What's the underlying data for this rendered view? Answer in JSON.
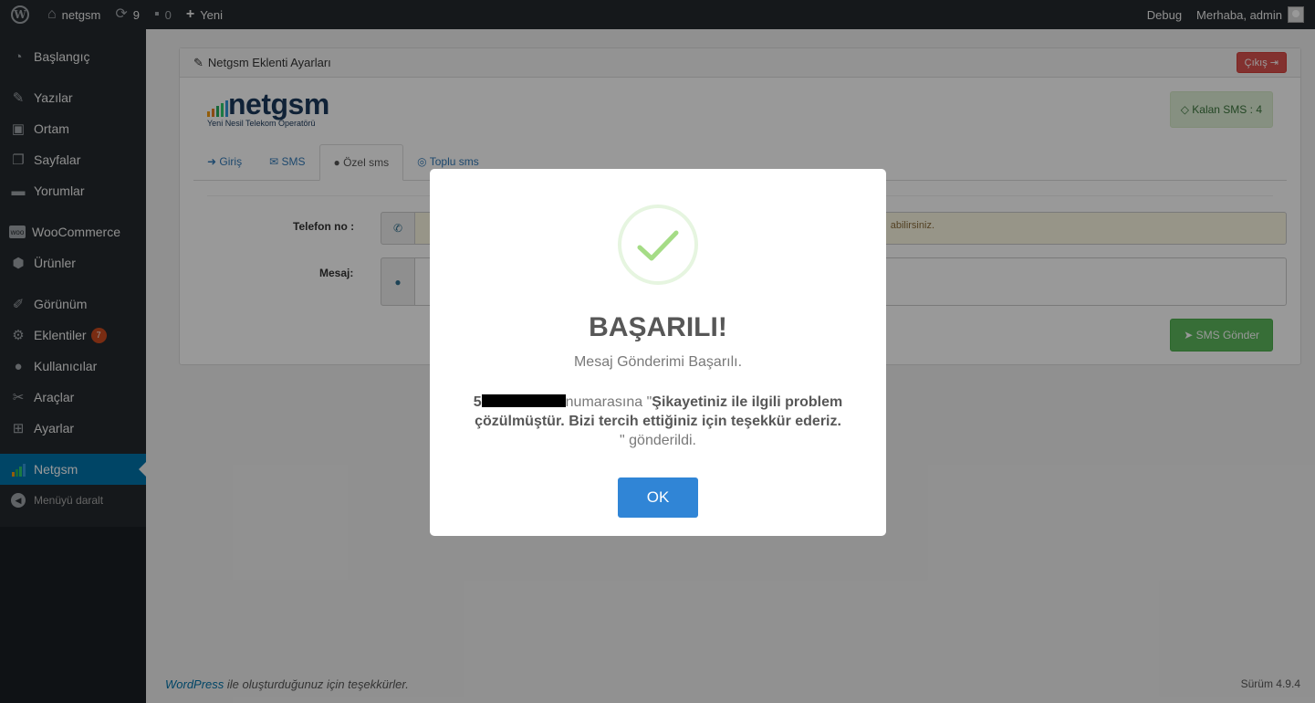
{
  "adminbar": {
    "site_name": "netgsm",
    "updates_count": "9",
    "comments_count": "0",
    "new_label": "Yeni",
    "debug_label": "Debug",
    "greeting": "Merhaba, admin"
  },
  "sidebar": {
    "items": [
      {
        "label": "Başlangıç",
        "icon": "dashboard-icon"
      },
      {
        "label": "Yazılar",
        "icon": "pin-icon"
      },
      {
        "label": "Ortam",
        "icon": "media-icon"
      },
      {
        "label": "Sayfalar",
        "icon": "pages-icon"
      },
      {
        "label": "Yorumlar",
        "icon": "comments-icon"
      },
      {
        "label": "WooCommerce",
        "icon": "woo-icon"
      },
      {
        "label": "Ürünler",
        "icon": "box-icon"
      },
      {
        "label": "Görünüm",
        "icon": "brush-icon"
      },
      {
        "label": "Eklentiler",
        "icon": "plugin-icon",
        "badge": "7"
      },
      {
        "label": "Kullanıcılar",
        "icon": "user-icon"
      },
      {
        "label": "Araçlar",
        "icon": "wrench-icon"
      },
      {
        "label": "Ayarlar",
        "icon": "settings-icon"
      },
      {
        "label": "Netgsm",
        "icon": "netgsm-bars-icon"
      }
    ],
    "collapse_label": "Menüyü daralt"
  },
  "panel": {
    "title": "Netgsm Eklenti Ayarları",
    "exit_label": "Çıkış",
    "logo_text": "netgsm",
    "logo_subtitle": "Yeni Nesil Telekom Operatörü",
    "kalan_sms": "Kalan SMS : 4",
    "tabs": [
      "Giriş",
      "SMS",
      "Özel sms",
      "Toplu sms"
    ],
    "phone_label": "Telefon no :",
    "message_label": "Mesaj:",
    "phone_hint_fragment": "abilirsiniz.",
    "send_label": "SMS Gönder"
  },
  "footer": {
    "wp_link": "WordPress",
    "thanks": " ile oluşturduğunuz için teşekkürler.",
    "version": "Sürüm 4.9.4"
  },
  "modal": {
    "title": "BAŞARILI!",
    "subtitle": "Mesaj Gönderimi Başarılı.",
    "number_prefix": "5",
    "numarasina": "numarasına \"",
    "message_body": "Şikayetiniz ile ilgili problem çözülmüştür. Bizi tercih ettiğiniz için teşekkür ederiz.",
    "gonderildi": "\" gönderildi.",
    "ok_label": "OK"
  },
  "colors": {
    "adminbar_bg": "#23282d",
    "menu_current": "#0073aa",
    "success_green": "#a5dc86",
    "ok_button": "#3085d6"
  }
}
